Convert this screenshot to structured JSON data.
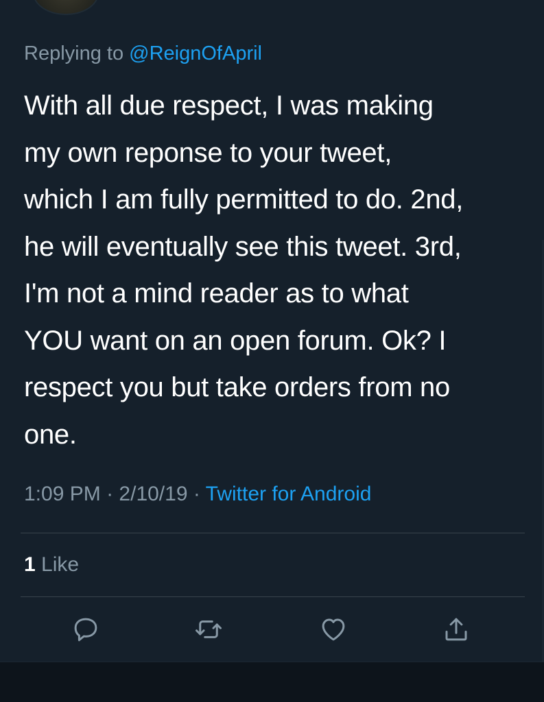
{
  "reply": {
    "prefix": "Replying to",
    "handle": "@ReignOfApril"
  },
  "tweet": {
    "text": "With all due respect, I was making\nmy own reponse to your tweet,\nwhich I am fully permitted to do. 2nd,\nhe will eventually see this tweet. 3rd,\nI'm not a mind reader as to what\nYOU want on an open forum. Ok? I\nrespect you but take orders from no\none."
  },
  "meta": {
    "time": "1:09 PM",
    "separator": "·",
    "date": "2/10/19",
    "source": "Twitter for Android"
  },
  "stats": {
    "like_count": "1",
    "like_label": "Like"
  },
  "actions": {
    "reply_icon": "reply-bubble-icon",
    "retweet_icon": "retweet-icon",
    "like_icon": "heart-icon",
    "share_icon": "share-icon"
  },
  "colors": {
    "background": "#15202b",
    "text": "#ffffff",
    "muted": "#8899a6",
    "accent": "#1da1f2",
    "divider": "#38444d"
  }
}
